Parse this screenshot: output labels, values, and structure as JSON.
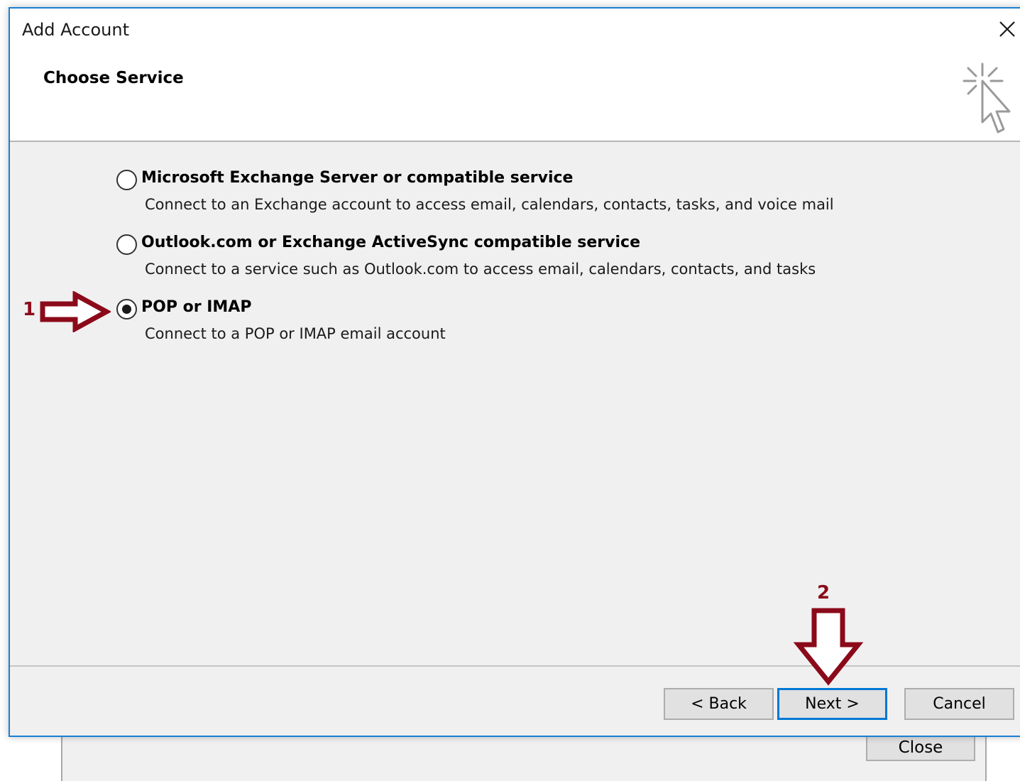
{
  "dialog": {
    "title": "Add Account",
    "subtitle": "Choose Service"
  },
  "options": [
    {
      "label": "Microsoft Exchange Server or compatible service",
      "description": "Connect to an Exchange account to access email, calendars, contacts, tasks, and voice mail",
      "selected": false
    },
    {
      "label": "Outlook.com or Exchange ActiveSync compatible service",
      "description": "Connect to a service such as Outlook.com to access email, calendars, contacts, and tasks",
      "selected": false
    },
    {
      "label": "POP or IMAP",
      "description": "Connect to a POP or IMAP email account",
      "selected": true
    }
  ],
  "buttons": {
    "back": "< Back",
    "next": "Next >",
    "cancel": "Cancel"
  },
  "background_window": {
    "close": "Close"
  },
  "annotations": {
    "step1": "1",
    "step2": "2",
    "color": "#8b0a1a"
  },
  "icons": [
    "close-icon",
    "wizard-cursor-icon",
    "arrow-right-icon",
    "arrow-down-icon"
  ]
}
